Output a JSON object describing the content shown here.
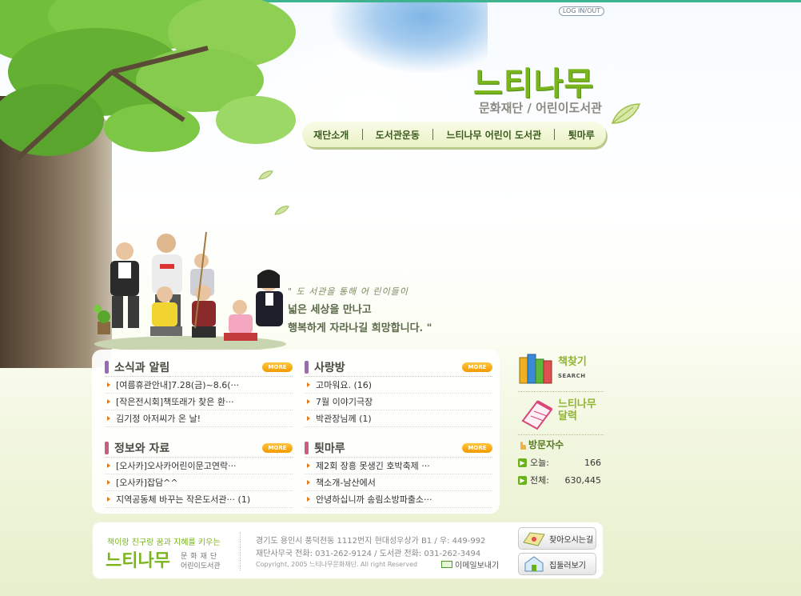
{
  "header": {
    "login_label": "LOG IN/OUT",
    "logo_title": "느티나무",
    "logo_subtitle": "문화재단 / 어린이도서관"
  },
  "nav": {
    "items": [
      {
        "label": "재단소개"
      },
      {
        "label": "도서관운동"
      },
      {
        "label": "느티나무 어린이 도서관"
      },
      {
        "label": "툇마루"
      }
    ]
  },
  "slogan": {
    "small": "\" 도 서관을 통해 어 린이들이",
    "line1": "넓은 세상을 만나고",
    "line2": "행복하게 자라나길 희망합니다. \""
  },
  "board": {
    "more_label": "MORE",
    "sections": [
      {
        "title": "소식과 알림",
        "color": "#9a6ab8",
        "items": [
          "[여름휴관안내]7.28(금)~8.6(···",
          "[작은전시회]책또래가 찾은 환···",
          "김기정 아저씨가 온 날!"
        ]
      },
      {
        "title": "사랑방",
        "color": "#9a6ab8",
        "items": [
          "고마워요. (16)",
          "7월 이야기극장",
          "박관장님께 (1)"
        ]
      },
      {
        "title": "정보와 자료",
        "color": "#c7607a",
        "items": [
          "[오사카]오사카어린이문고연락···",
          "[오사카]잡담^^",
          "지역공동체 바꾸는 작은도서관··· (1)"
        ]
      },
      {
        "title": "툇마루",
        "color": "#c7607a",
        "items": [
          "제2회 장흥 못생긴 호박축제 ···",
          "책소개-남산에서",
          "안녕하십니까 송림소방파출소···"
        ]
      }
    ]
  },
  "side": {
    "book_search": {
      "label": "책찾기",
      "en": "SEARCH"
    },
    "calendar": {
      "label_line1": "느티나무",
      "label_line2": "달력"
    },
    "visitors": {
      "title": "방문자수",
      "today_label": "오늘:",
      "today_value": "166",
      "total_label": "전체:",
      "total_value": "630,445"
    }
  },
  "footer": {
    "slogan": "책이랑 친구랑 꿈과 지혜를 키우는",
    "logo": "느티나무",
    "logo_sub1": "문화재단",
    "logo_sub2": "어린이도서관",
    "address": "경기도 용인시 풍덕천동 1112번지 현대성우상가 B1 / 우: 449-992",
    "phone": "재단사무국 전화: 031-262-9124 / 도서관 전화: 031-262-3494",
    "copyright": "Copyright, 2005 느티나무문화재단. All right Reserved",
    "mail_label": "이메일보내기",
    "directions_label": "찾아오시는길",
    "tour_label": "집둘러보기"
  },
  "colors": {
    "brand_green": "#7ab51d",
    "more_orange": "#f39a00",
    "topbar": "#3fb28f"
  }
}
